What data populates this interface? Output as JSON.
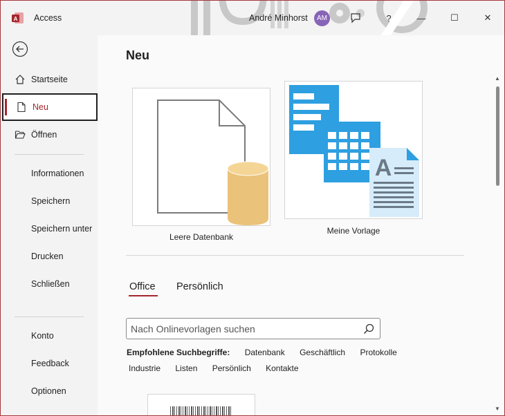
{
  "app": {
    "title": "Access",
    "user_name": "André Minhorst",
    "user_initials": "AM",
    "accent": "#a4262c",
    "avatar_color": "#8764b8"
  },
  "window_controls": {
    "feedback_icon": "comment-icon",
    "help": "?",
    "minimize": "—",
    "maximize": "☐",
    "close": "✕"
  },
  "sidebar": {
    "top_items": [
      {
        "label": "Startseite",
        "icon": "home-icon"
      },
      {
        "label": "Neu",
        "icon": "new-file-icon",
        "active": true
      },
      {
        "label": "Öffnen",
        "icon": "folder-open-icon"
      }
    ],
    "middle_items": [
      {
        "label": "Informationen"
      },
      {
        "label": "Speichern"
      },
      {
        "label": "Speichern unter"
      },
      {
        "label": "Drucken"
      },
      {
        "label": "Schließen"
      }
    ],
    "bottom_items": [
      {
        "label": "Konto"
      },
      {
        "label": "Feedback"
      },
      {
        "label": "Optionen"
      }
    ]
  },
  "main": {
    "title": "Neu",
    "templates": [
      {
        "label": "Leere Datenbank",
        "icon": "blank-database-icon"
      },
      {
        "label": "Meine Vorlage",
        "icon": "custom-template-icon"
      }
    ],
    "tabs": [
      {
        "label": "Office",
        "active": true
      },
      {
        "label": "Persönlich"
      }
    ],
    "search": {
      "placeholder": "Nach Onlinevorlagen suchen"
    },
    "suggestions": {
      "heading": "Empfohlene Suchbegriffe:",
      "row1": [
        "Datenbank",
        "Geschäftlich",
        "Protokolle"
      ],
      "row2": [
        "Industrie",
        "Listen",
        "Persönlich",
        "Kontakte"
      ]
    }
  }
}
